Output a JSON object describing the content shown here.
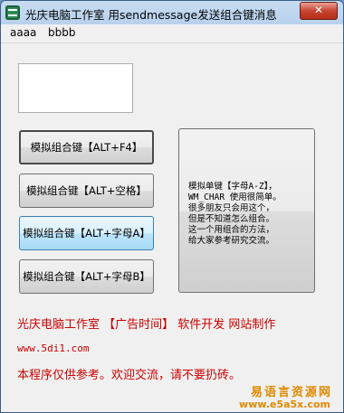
{
  "window": {
    "title": "光庆电脑工作室  用sendmessage发送组合键消息",
    "close_label": "✕"
  },
  "menu": [
    "aaaa",
    "bbbb"
  ],
  "buttons": [
    "模拟组合键【ALT+F4】",
    "模拟组合键【ALT+空格】",
    "模拟组合键【ALT+字母A】",
    "模拟组合键【ALT+字母B】"
  ],
  "single_key_button": {
    "lines": [
      "模拟单键【字母A-Z】，",
      "WM_CHAR 使用很简单。",
      "很多朋友只会用这个，",
      "但是不知道怎么组合。",
      "这一个用组合的方法，",
      "给大家参考研究交流。"
    ]
  },
  "ad_line": "光庆电脑工作室  【广告时间】  软件开发  网站制作",
  "url": "www.5di1.com",
  "notice": "本程序仅供参考。欢迎交流，请不要扔砖。",
  "watermark": {
    "line1": "易语言资源网",
    "line2": "www.e5a5x.com"
  },
  "colors": {
    "accent_text": "#cc0000",
    "watermark": "#e08a00"
  }
}
